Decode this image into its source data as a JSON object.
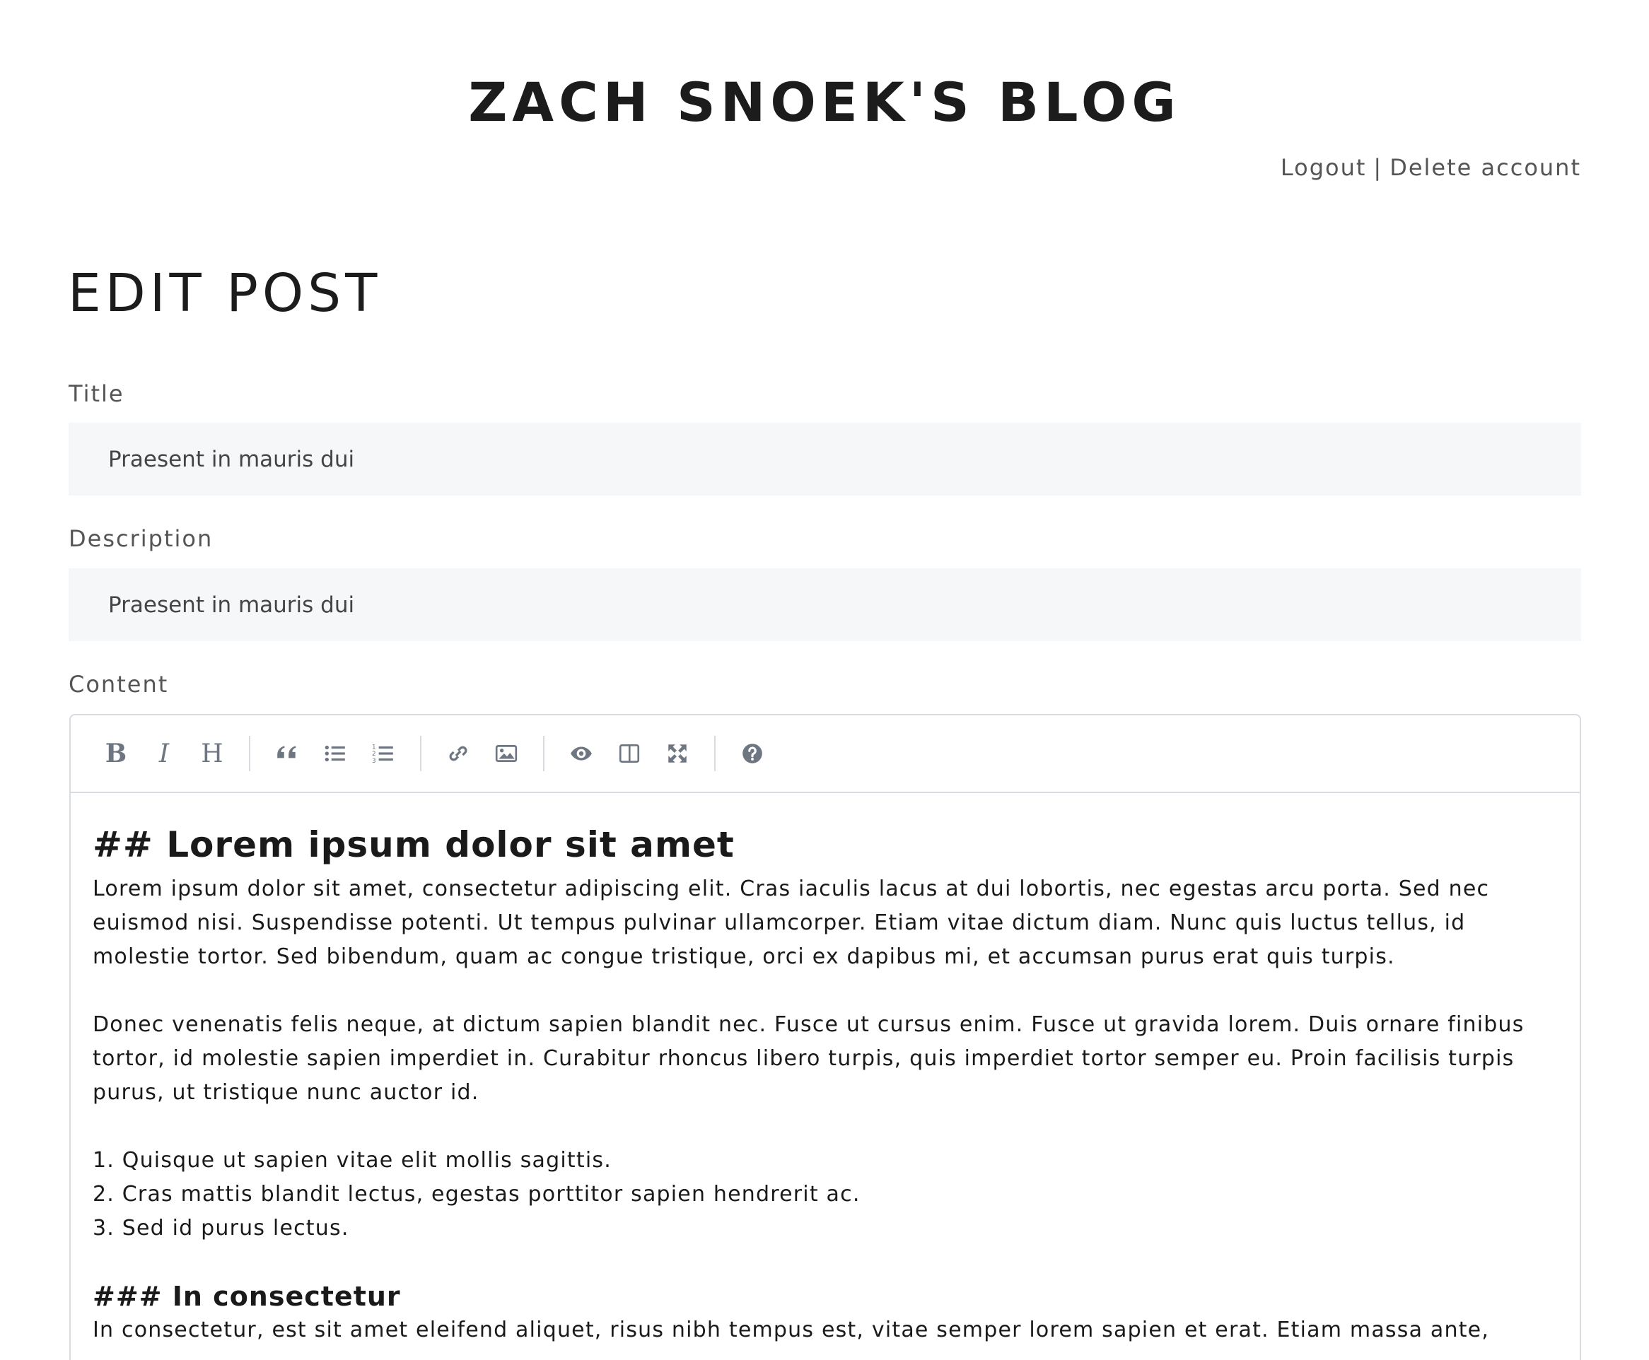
{
  "site": {
    "title": "ZACH SNOEK'S BLOG"
  },
  "account": {
    "logout": "Logout",
    "separator": "|",
    "delete": "Delete account"
  },
  "page": {
    "heading": "EDIT POST"
  },
  "form": {
    "title_label": "Title",
    "title_value": "Praesent in mauris dui",
    "description_label": "Description",
    "description_value": "Praesent in mauris dui",
    "content_label": "Content"
  },
  "toolbar": {
    "bold": "B",
    "italic": "I",
    "heading": "H"
  },
  "content": {
    "h2": "## Lorem ipsum dolor sit amet",
    "p1_l1": "Lorem ipsum dolor sit amet, consectetur adipiscing elit. Cras iaculis lacus at dui lobortis, nec egestas arcu porta. Sed nec",
    "p1_l2": "euismod nisi. Suspendisse potenti. Ut tempus pulvinar ullamcorper. Etiam vitae dictum diam. Nunc quis luctus tellus, id",
    "p1_l3": "molestie tortor. Sed bibendum, quam ac congue tristique, orci ex dapibus mi, et accumsan purus erat quis turpis.",
    "p2_l1": "Donec venenatis felis neque, at dictum sapien blandit nec. Fusce ut cursus enim. Fusce ut gravida lorem. Duis ornare finibus",
    "p2_l2": "tortor, id molestie sapien imperdiet in. Curabitur rhoncus libero turpis, quis imperdiet tortor semper eu. Proin facilisis turpis",
    "p2_l3": "purus, ut tristique nunc auctor id.",
    "li1": "1. Quisque ut sapien vitae elit mollis sagittis.",
    "li2": "2. Cras mattis blandit lectus, egestas porttitor sapien hendrerit ac.",
    "li3": "3. Sed id purus lectus.",
    "h3": "### In consectetur",
    "p3_l1": "In consectetur, est sit amet eleifend aliquet, risus nibh tempus est, vitae semper lorem sapien et erat. Etiam massa ante,"
  }
}
